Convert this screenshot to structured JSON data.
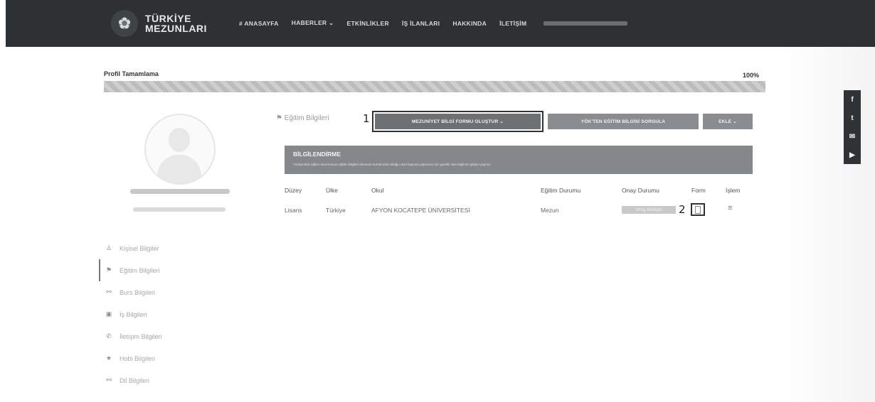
{
  "nav": {
    "logo_text_line1": "TÜRKİYE",
    "logo_text_line2": "MEZUNLARI",
    "items": [
      "# ANASAYFA",
      "HABERLER ⌄",
      "ETKİNLİKLER",
      "İŞ İLANLARI",
      "HAKKINDA",
      "İLETİŞİM"
    ]
  },
  "profile": {
    "title": "Profil Tamamlama",
    "percent_label": "100%",
    "percent": 100
  },
  "sidebar": {
    "items": [
      {
        "label": "Kişisel Bilgiler",
        "icon": "person-icon"
      },
      {
        "label": "Eğitim Bilgileri",
        "icon": "graduation-icon",
        "active": true
      },
      {
        "label": "Burs Bilgileri",
        "icon": "scholarship-icon"
      },
      {
        "label": "İş Bilgileri",
        "icon": "briefcase-icon"
      },
      {
        "label": "İletişim Bilgileri",
        "icon": "phone-icon"
      },
      {
        "label": "Hobi Bilgileri",
        "icon": "star-icon"
      },
      {
        "label": "Dil Bilgileri",
        "icon": "language-icon"
      }
    ]
  },
  "education": {
    "header_label": "Eğitim Bilgileri",
    "callout_1": "1",
    "callout_2": "2",
    "buttons": {
      "create_form": "MEZUNİYET BİLGİ FORMU OLUŞTUR ⌄",
      "yok_request": "YÖK'TEN EĞİTİM BİLGİSİ SORGULA",
      "add": "EKLE ⌄"
    },
    "info": {
      "title": "BİLGİLENDİRME",
      "text": "Türkiye'deki eğitim durumunuzu eğitim bilgileri ekranına dumanızda olduğu nasıl başvuru yapmanız için gerekli olan bilgilerin girişini yapınız."
    },
    "columns": [
      "Düzey",
      "Ülke",
      "Okul",
      "Eğitim Durumu",
      "Onay Durumu",
      "Form",
      "İşlem"
    ],
    "rows": [
      {
        "level": "Lisans",
        "country": "Türkiye",
        "school": "AFYON KOCATEPE ÜNİVERSİTESİ",
        "status": "Mezun",
        "approval": "Onay Bekliyor"
      }
    ]
  },
  "social": [
    "f",
    "t",
    "✉",
    "▶"
  ]
}
